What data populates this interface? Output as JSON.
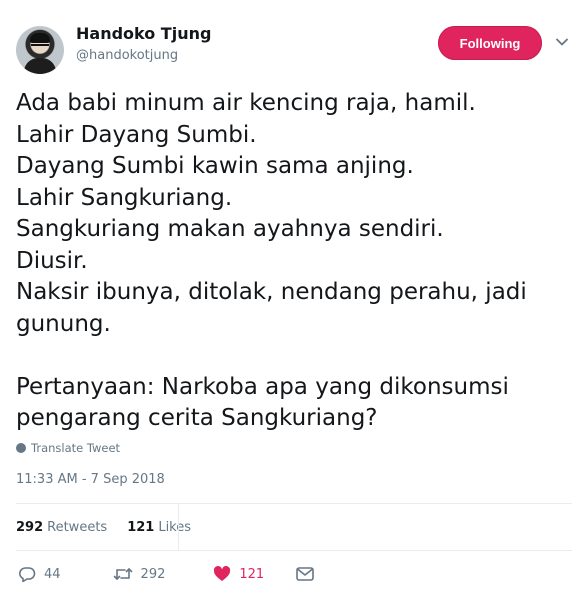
{
  "header": {
    "name": "Handoko Tjung",
    "handle": "@handokotjung",
    "follow_label": "Following"
  },
  "tweet": {
    "text": "Ada babi minum air kencing raja, hamil.\nLahir Dayang Sumbi.\nDayang Sumbi kawin sama anjing.\nLahir Sangkuriang.\nSangkuriang makan ayahnya sendiri.\nDiusir.\nNaksir ibunya, ditolak, nendang perahu, jadi gunung.\n\nPertanyaan: Narkoba apa yang dikonsumsi pengarang cerita Sangkuriang?",
    "translate_label": "Translate Tweet",
    "timestamp": "11:33 AM - 7 Sep 2018"
  },
  "stats": {
    "retweets_count": "292",
    "retweets_label": "Retweets",
    "likes_count": "121",
    "likes_label": "Likes"
  },
  "actions": {
    "reply_count": "44",
    "retweet_count": "292",
    "like_count": "121"
  },
  "colors": {
    "accent": "#e0245e",
    "secondary_text": "#657786",
    "primary_text": "#14171a"
  },
  "icons": [
    "chevron-down-icon",
    "globe-icon",
    "reply-icon",
    "retweet-icon",
    "heart-icon",
    "message-icon"
  ]
}
